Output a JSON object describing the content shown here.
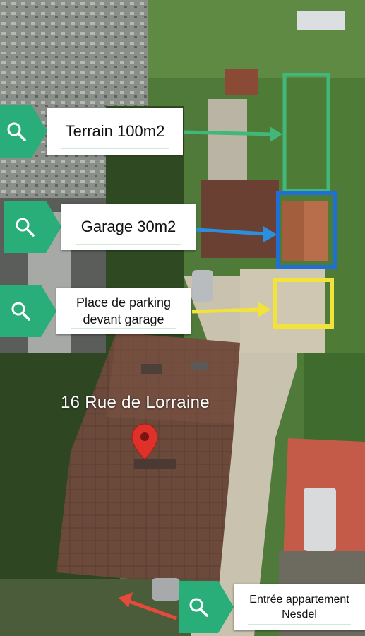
{
  "labels": {
    "terrain": "Terrain 100m2",
    "garage": "Garage 30m2",
    "parking": "Place de parking devant garage",
    "entree": "Entrée appartement Nesdel"
  },
  "address": "16 Rue de Lorraine",
  "icons": {
    "search": "search-icon",
    "pin": "map-pin-icon"
  },
  "colors": {
    "tag_green": "#2aae79",
    "terrain_frame": "#41b87a",
    "garage_frame": "#1f6fd6",
    "parking_frame": "#f2e33a",
    "entree_arrow": "#e64a3b",
    "pin_red": "#e0302a"
  }
}
